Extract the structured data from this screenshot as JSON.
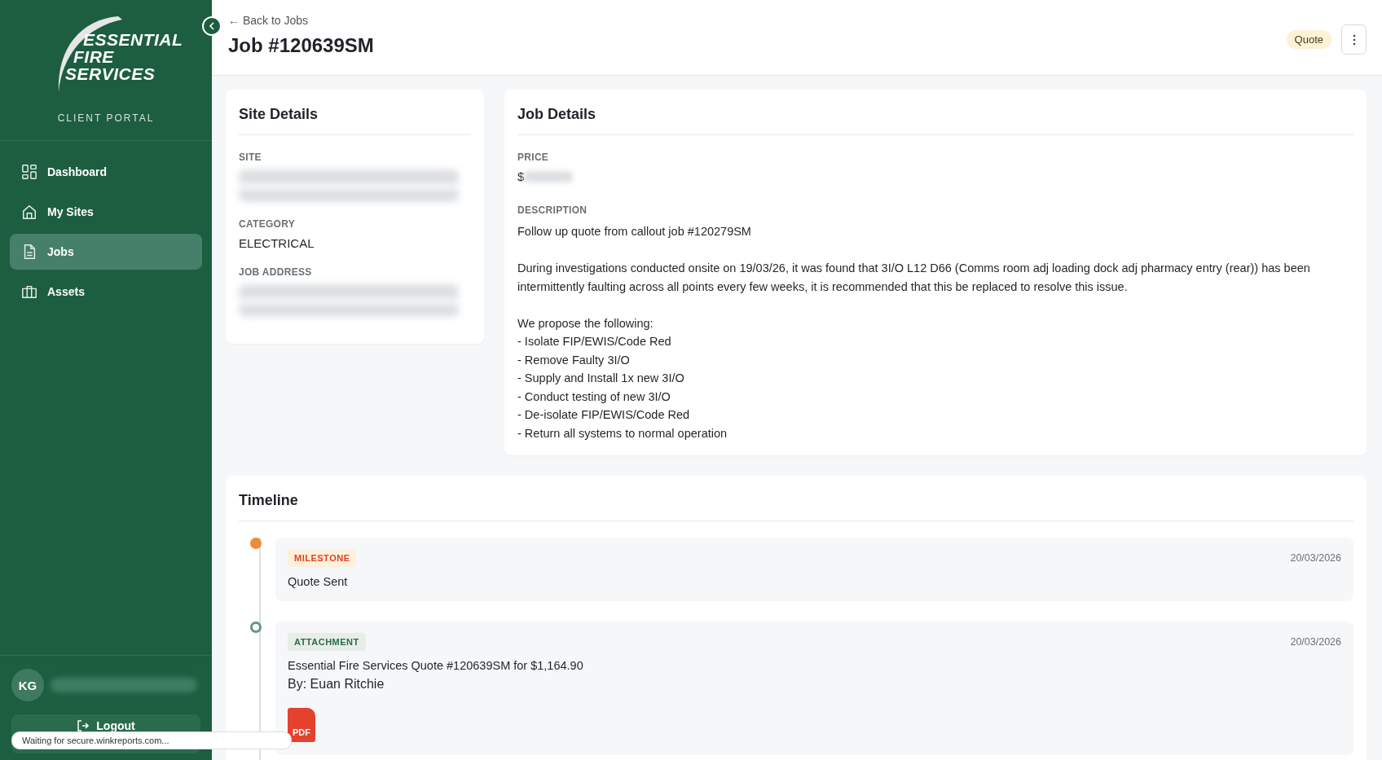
{
  "sidebar": {
    "logo_lines": [
      "ESSENTIAL",
      "FIRE",
      "SERVICES"
    ],
    "subtitle": "CLIENT PORTAL",
    "items": [
      {
        "label": "Dashboard",
        "selected": false
      },
      {
        "label": "My Sites",
        "selected": false
      },
      {
        "label": "Jobs",
        "selected": true
      },
      {
        "label": "Assets",
        "selected": false
      }
    ],
    "user": {
      "initials": "KG"
    },
    "logout": "Logout"
  },
  "header": {
    "back": "← Back to Jobs",
    "title": "Job #120639SM",
    "status": "Quote"
  },
  "site_details": {
    "title": "Site Details",
    "fields": [
      {
        "label": "SITE",
        "redacted": true
      },
      {
        "label": "CATEGORY",
        "value": "ELECTRICAL"
      },
      {
        "label": "JOB ADDRESS",
        "redacted": true
      }
    ]
  },
  "job_details": {
    "title": "Job Details",
    "price_label": "PRICE",
    "price_prefix": "$",
    "description_label": "DESCRIPTION",
    "description": [
      [
        "Follow up quote from callout job #120279SM"
      ],
      [
        "During investigations conducted onsite on 19/03/26, it was found that 3I/O L12 D66 (Comms room adj loading dock adj pharmacy entry (rear)) has been intermittently faulting across all points every few weeks, it is recommended that this be replaced to resolve this issue."
      ],
      [
        "We propose the following:",
        "- Isolate FIP/EWIS/Code Red",
        "- Remove Faulty 3I/O",
        "- Supply and Install 1x new 3I/O",
        "- Conduct testing of new 3I/O",
        "- De-isolate FIP/EWIS/Code Red",
        "- Return all systems to normal operation"
      ]
    ]
  },
  "timeline": {
    "title": "Timeline",
    "events": [
      {
        "kind": "milestone",
        "tag": "MILESTONE",
        "date": "20/03/2026",
        "text": "Quote Sent"
      },
      {
        "kind": "attachment",
        "tag": "ATTACHMENT",
        "date": "20/03/2026",
        "text": "Essential Fire Services Quote #120639SM for $1,164.90",
        "by": "By: Euan Ritchie",
        "file": "PDF"
      }
    ]
  },
  "status_bar": "Waiting for secure.winkreports.com..."
}
